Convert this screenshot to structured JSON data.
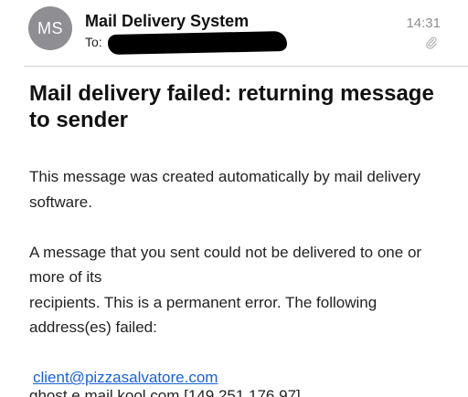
{
  "header": {
    "avatar_initials": "MS",
    "sender_name": "Mail Delivery System",
    "to_label": "To:",
    "time": "14:31",
    "attachment_icon": "paperclip-icon",
    "avatar_color": "#8e8e93"
  },
  "message": {
    "subject": "Mail delivery failed: returning message to sender",
    "paragraph_1": "This message was created automatically by mail delivery software.",
    "paragraph_2_line_1": "A message that you sent could not be delivered to one or more of its",
    "paragraph_2_line_2": "recipients. This is a permanent error. The following address(es) failed:",
    "failed_address": "client@pizzasalvatore.com",
    "cutoff_text": "ghost.e.mail.kool.com [149.251.176.97]"
  },
  "colors": {
    "link": "#1a62d8",
    "secondary_text": "#8e8e93"
  }
}
